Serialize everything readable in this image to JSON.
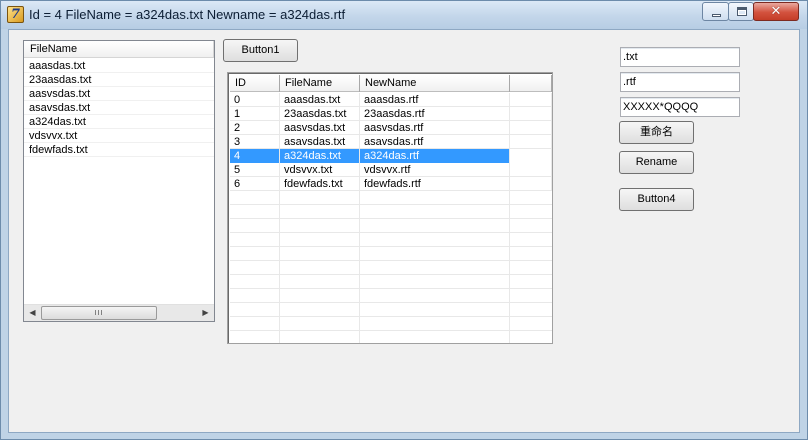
{
  "window": {
    "title": "Id = 4 FileName = a324das.txt Newname = a324das.rtf",
    "close_glyph": "✕"
  },
  "file_list": {
    "header": "FileName",
    "items": [
      "aaasdas.txt",
      "23aasdas.txt",
      "aasvsdas.txt",
      "asavsdas.txt",
      "a324das.txt",
      "vdsvvx.txt",
      "fdewfads.txt"
    ],
    "scroll_left": "◀",
    "scroll_right": "▶",
    "thumb_grip": "III"
  },
  "buttons": {
    "button1": "Button1",
    "rename_cn": "重命名",
    "rename": "Rename",
    "button4": "Button4"
  },
  "grid": {
    "columns": [
      "ID",
      "FileName",
      "NewName",
      ""
    ],
    "rows": [
      {
        "id": "0",
        "filename": "aaasdas.txt",
        "newname": "aaasdas.rtf"
      },
      {
        "id": "1",
        "filename": "23aasdas.txt",
        "newname": "23aasdas.rtf"
      },
      {
        "id": "2",
        "filename": "aasvsdas.txt",
        "newname": "aasvsdas.rtf"
      },
      {
        "id": "3",
        "filename": "asavsdas.txt",
        "newname": "asavsdas.rtf"
      },
      {
        "id": "4",
        "filename": "a324das.txt",
        "newname": "a324das.rtf"
      },
      {
        "id": "5",
        "filename": "vdsvvx.txt",
        "newname": "vdsvvx.rtf"
      },
      {
        "id": "6",
        "filename": "fdewfads.txt",
        "newname": "fdewfads.rtf"
      }
    ],
    "selected_row_index": 4
  },
  "inputs": {
    "old_ext": ".txt",
    "new_ext": ".rtf",
    "pattern": "XXXXX*QQQQ"
  },
  "icons": {
    "app": "delphi-app-icon",
    "minimize": "minimize-icon",
    "maximize": "maximize-icon",
    "close": "close-icon"
  },
  "colors": {
    "selection": "#3399ff",
    "titlebar": "#c3d6ea",
    "close_button": "#d3523e"
  }
}
